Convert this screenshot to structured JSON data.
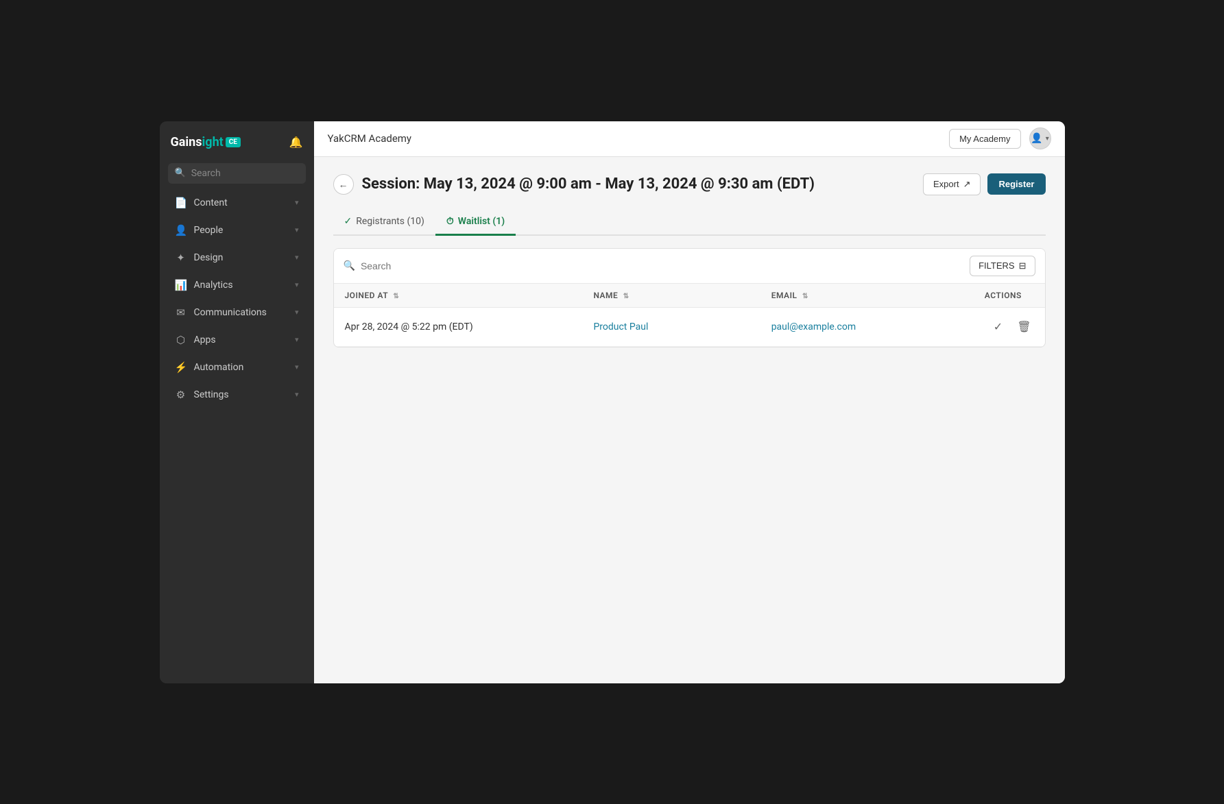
{
  "app": {
    "logo": "Gainsight",
    "logo_accent": "CE",
    "bell_label": "🔔"
  },
  "sidebar": {
    "search_placeholder": "Search",
    "items": [
      {
        "id": "content",
        "label": "Content",
        "icon": "📄",
        "has_chevron": true
      },
      {
        "id": "people",
        "label": "People",
        "icon": "👤",
        "has_chevron": true
      },
      {
        "id": "design",
        "label": "Design",
        "icon": "🎨",
        "has_chevron": true
      },
      {
        "id": "analytics",
        "label": "Analytics",
        "icon": "📊",
        "has_chevron": true
      },
      {
        "id": "communications",
        "label": "Communications",
        "icon": "✉️",
        "has_chevron": true
      },
      {
        "id": "apps",
        "label": "Apps",
        "icon": "🔧",
        "has_chevron": true
      },
      {
        "id": "automation",
        "label": "Automation",
        "icon": "⚡",
        "has_chevron": true
      },
      {
        "id": "settings",
        "label": "Settings",
        "icon": "⚙️",
        "has_chevron": true
      }
    ]
  },
  "topbar": {
    "title": "YakCRM Academy",
    "my_academy_label": "My Academy",
    "user_icon": "👤"
  },
  "page": {
    "title": "Session: May 13, 2024 @ 9:00 am - May 13, 2024 @ 9:30 am (EDT)",
    "export_label": "Export",
    "register_label": "Register"
  },
  "tabs": [
    {
      "id": "registrants",
      "label": "Registrants (10)",
      "icon": "✓",
      "active": false
    },
    {
      "id": "waitlist",
      "label": "Waitlist (1)",
      "icon": "⏱",
      "active": true
    }
  ],
  "table": {
    "search_placeholder": "Search",
    "filters_label": "FILTERS",
    "columns": [
      {
        "id": "joined_at",
        "label": "JOINED AT"
      },
      {
        "id": "name",
        "label": "NAME"
      },
      {
        "id": "email",
        "label": "EMAIL"
      },
      {
        "id": "actions",
        "label": "ACTIONS"
      }
    ],
    "rows": [
      {
        "joined_at": "Apr 28, 2024 @ 5:22 pm (EDT)",
        "name": "Product Paul",
        "email": "paul@example.com"
      }
    ]
  }
}
